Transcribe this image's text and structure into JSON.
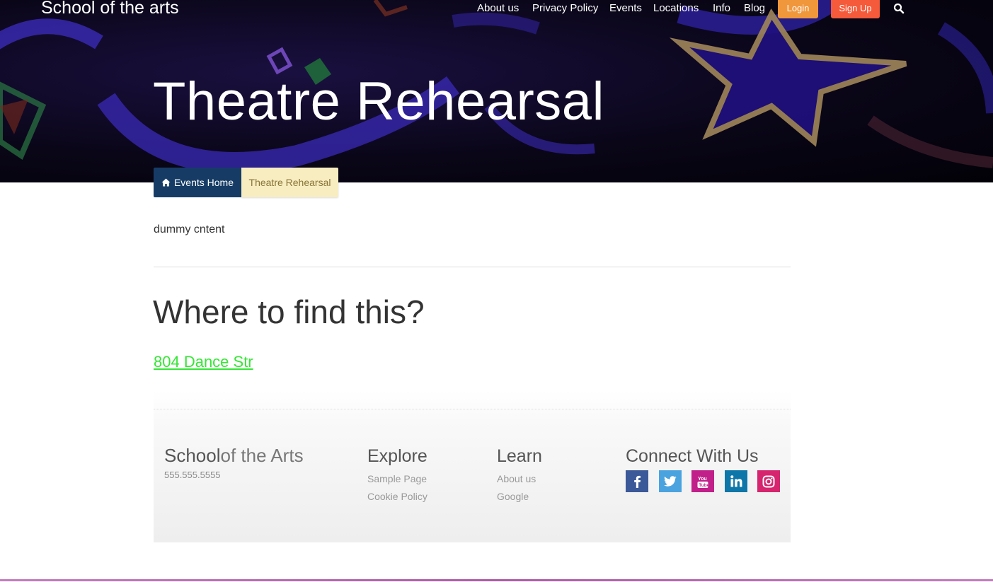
{
  "header": {
    "brand_bold": "School",
    "brand_light": " of the arts",
    "nav": [
      "About us",
      "Privacy Policy",
      "Events",
      "Locations",
      "Info",
      "Blog"
    ],
    "login_label": "Login",
    "signup_label": "Sign Up",
    "login_color": "#f0973c",
    "signup_color": "#f55a3a"
  },
  "hero": {
    "title": "Theatre Rehearsal"
  },
  "breadcrumb": {
    "home_label": "Events Home",
    "current_label": "Theatre Rehearsal"
  },
  "content": {
    "body": "dummy cntent",
    "section_title": "Where to find this?",
    "address": "804 Dance Str"
  },
  "footer": {
    "brand_bold": "School",
    "brand_light": "of the Arts",
    "phone": "555.555.5555",
    "explore_title": "Explore",
    "explore_links": [
      "Sample Page",
      "Cookie Policy"
    ],
    "learn_title": "Learn",
    "learn_links": [
      "About us",
      "Google"
    ],
    "connect_title": "Connect With Us",
    "social": [
      {
        "icon": "facebook-icon",
        "color": "#3b5998"
      },
      {
        "icon": "twitter-icon",
        "color": "#4aa3df"
      },
      {
        "icon": "youtube-icon",
        "color": "#c1208a"
      },
      {
        "icon": "linkedin-icon",
        "color": "#0e76a8"
      },
      {
        "icon": "instagram-icon",
        "color": "#d6246e"
      }
    ]
  }
}
